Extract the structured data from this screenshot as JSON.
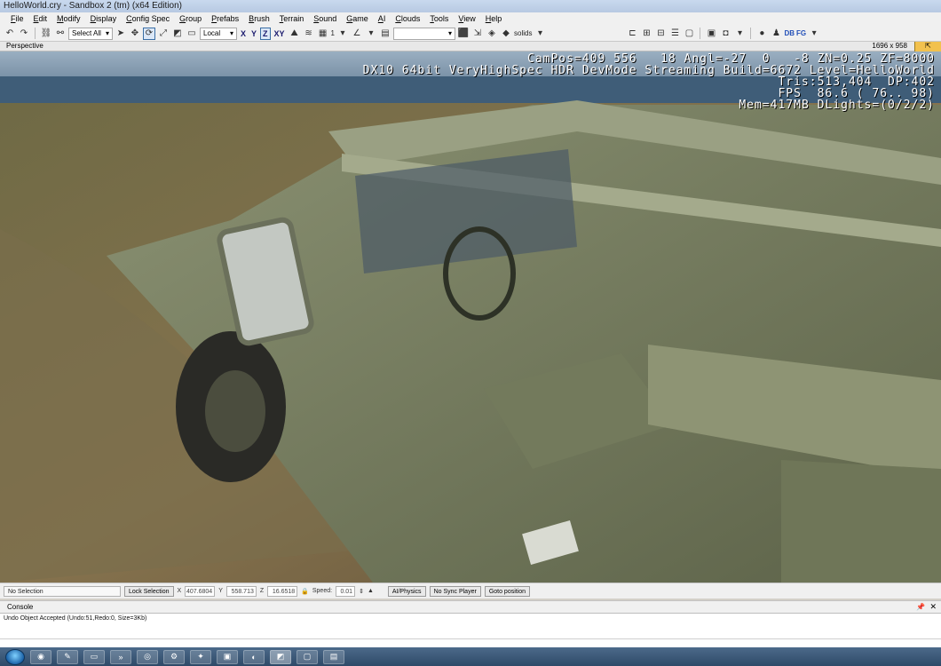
{
  "window": {
    "title": "HelloWorld.cry - Sandbox 2 (tm) (x64 Edition)"
  },
  "menu": [
    {
      "label": "File",
      "u": "F",
      "rest": "ile"
    },
    {
      "label": "Edit",
      "u": "E",
      "rest": "dit"
    },
    {
      "label": "Modify",
      "u": "M",
      "rest": "odify"
    },
    {
      "label": "Display",
      "u": "D",
      "rest": "isplay"
    },
    {
      "label": "Config Spec",
      "u": "C",
      "rest": "onfig Spec"
    },
    {
      "label": "Group",
      "u": "G",
      "rest": "roup"
    },
    {
      "label": "Prefabs",
      "u": "P",
      "rest": "refabs"
    },
    {
      "label": "Brush",
      "u": "B",
      "rest": "rush"
    },
    {
      "label": "Terrain",
      "u": "T",
      "rest": "errain"
    },
    {
      "label": "Sound",
      "u": "S",
      "rest": "ound"
    },
    {
      "label": "Game",
      "u": "G",
      "rest": "ame"
    },
    {
      "label": "AI",
      "u": "A",
      "rest": "I"
    },
    {
      "label": "Clouds",
      "u": "C",
      "rest": "louds"
    },
    {
      "label": "Tools",
      "u": "T",
      "rest": "ools"
    },
    {
      "label": "View",
      "u": "V",
      "rest": "iew"
    },
    {
      "label": "Help",
      "u": "H",
      "rest": "elp"
    }
  ],
  "toolbar": {
    "select_all": "Select All",
    "coord_system": "Local",
    "axis_x": "X",
    "axis_y": "Y",
    "axis_z": "Z",
    "axis_xy": "XY",
    "snap_grid_value": "1",
    "solids_label": "solids",
    "db_label": "DB",
    "fg_label": "FG"
  },
  "viewport": {
    "name": "Perspective",
    "resolution": "1696 x 958",
    "hud_lines": [
      "CamPos=409 556   18 Angl=-27  0   -8 ZN=0.25 ZF=8000",
      "DX10 64bit VeryHighSpec HDR DevMode Streaming Build=6672 Level=HelloWorld",
      "Tris:513,404  DP:402",
      "FPS  86.6 ( 76.. 98)",
      "Mem=417MB DLights=(0/2/2)"
    ]
  },
  "status": {
    "selection": "No Selection",
    "lock_selection": "Lock Selection",
    "x_label": "X",
    "x_value": "407.6804",
    "y_label": "Y",
    "y_value": "558.713",
    "z_label": "Z",
    "z_value": "16.6518",
    "speed_label": "Speed:",
    "speed_value": "0.01",
    "ai_physics": "AI/Physics",
    "no_sync_player": "No Sync Player",
    "goto_position": "Goto position"
  },
  "console": {
    "title": "Console",
    "log": "Undo Object Accepted (Undo:51,Redo:0, Size=3Kb)"
  },
  "colors": {
    "sky": "#7d97ad",
    "water": "#3f5d78",
    "ground": "#7c6a48",
    "vehicle": "#7d8466",
    "hud_text": "#ffffff"
  }
}
